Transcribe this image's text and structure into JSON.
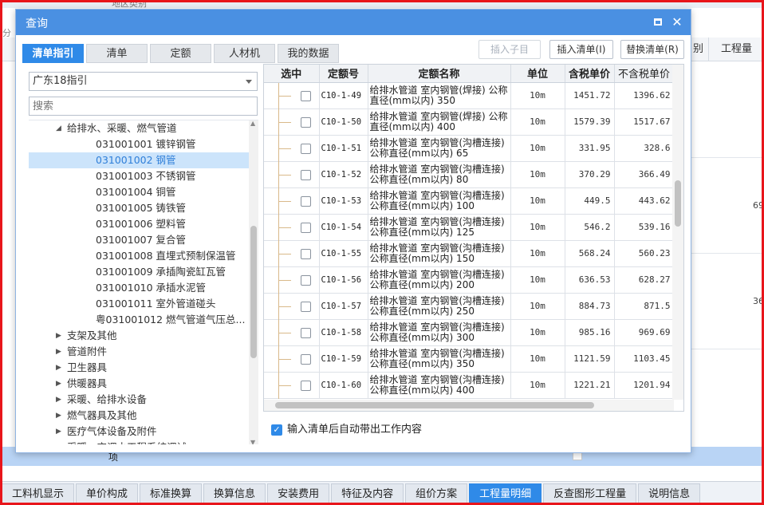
{
  "background": {
    "top_hint": "地区类别",
    "left_label": "分",
    "col_headers": [
      "别",
      "工程量"
    ],
    "right_values": [
      "69",
      "36"
    ],
    "row_label": "项"
  },
  "bottom_tabs": [
    "工料机显示",
    "单价构成",
    "标准换算",
    "换算信息",
    "安装费用",
    "特征及内容",
    "组价方案",
    "工程量明细",
    "反查图形工程量",
    "说明信息"
  ],
  "bottom_tabs_active": "工程量明细",
  "dialog": {
    "title": "查询",
    "tabs": [
      "清单指引",
      "清单",
      "定额",
      "人材机",
      "我的数据"
    ],
    "active_tab": "清单指引",
    "buttons": {
      "insert_child": "插入子目",
      "insert_list": "插入清单(I)",
      "replace_list": "替换清单(R)"
    },
    "select_value": "广东18指引",
    "search_placeholder": "搜索",
    "tree": [
      {
        "label": "给排水、采暖、燃气管道",
        "indent": 48,
        "arrow": "down"
      },
      {
        "label": "031001001  镀锌钢管",
        "indent": 84
      },
      {
        "label": "031001002  钢管",
        "indent": 84,
        "selected": true
      },
      {
        "label": "031001003  不锈钢管",
        "indent": 84
      },
      {
        "label": "031001004  铜管",
        "indent": 84
      },
      {
        "label": "031001005  铸铁管",
        "indent": 84
      },
      {
        "label": "031001006  塑料管",
        "indent": 84
      },
      {
        "label": "031001007  复合管",
        "indent": 84
      },
      {
        "label": "031001008  直埋式预制保温管",
        "indent": 84
      },
      {
        "label": "031001009  承插陶瓷缸瓦管",
        "indent": 84
      },
      {
        "label": "031001010  承插水泥管",
        "indent": 84
      },
      {
        "label": "031001011  室外管道碰头",
        "indent": 84
      },
      {
        "label": "粤031001012  燃气管道气压总...",
        "indent": 84
      },
      {
        "label": "支架及其他",
        "indent": 48,
        "arrow": "right"
      },
      {
        "label": "管道附件",
        "indent": 48,
        "arrow": "right"
      },
      {
        "label": "卫生器具",
        "indent": 48,
        "arrow": "right"
      },
      {
        "label": "供暖器具",
        "indent": 48,
        "arrow": "right"
      },
      {
        "label": "采暖、给排水设备",
        "indent": 48,
        "arrow": "right"
      },
      {
        "label": "燃气器具及其他",
        "indent": 48,
        "arrow": "right"
      },
      {
        "label": "医疗气体设备及附件",
        "indent": 48,
        "arrow": "right"
      },
      {
        "label": "采暖、空调水工程系统调试",
        "indent": 48,
        "arrow": "right"
      }
    ],
    "grid_headers": [
      "选中",
      "定额号",
      "定额名称",
      "单位",
      "含税单价",
      "不含税单价"
    ],
    "rows": [
      {
        "code": "C10-1-49",
        "name": "给排水管道 室内钢管(焊接) 公称直径(mm以内) 350",
        "unit": "10m",
        "tax_price": "1451.72",
        "notax_price": "1396.62"
      },
      {
        "code": "C10-1-50",
        "name": "给排水管道 室内钢管(焊接) 公称直径(mm以内) 400",
        "unit": "10m",
        "tax_price": "1579.39",
        "notax_price": "1517.67"
      },
      {
        "code": "C10-1-51",
        "name": "给排水管道 室内钢管(沟槽连接) 公称直径(mm以内) 65",
        "unit": "10m",
        "tax_price": "331.95",
        "notax_price": "328.6"
      },
      {
        "code": "C10-1-52",
        "name": "给排水管道 室内钢管(沟槽连接) 公称直径(mm以内) 80",
        "unit": "10m",
        "tax_price": "370.29",
        "notax_price": "366.49"
      },
      {
        "code": "C10-1-53",
        "name": "给排水管道 室内钢管(沟槽连接) 公称直径(mm以内) 100",
        "unit": "10m",
        "tax_price": "449.5",
        "notax_price": "443.62"
      },
      {
        "code": "C10-1-54",
        "name": "给排水管道 室内钢管(沟槽连接) 公称直径(mm以内) 125",
        "unit": "10m",
        "tax_price": "546.2",
        "notax_price": "539.16"
      },
      {
        "code": "C10-1-55",
        "name": "给排水管道 室内钢管(沟槽连接) 公称直径(mm以内) 150",
        "unit": "10m",
        "tax_price": "568.24",
        "notax_price": "560.23"
      },
      {
        "code": "C10-1-56",
        "name": "给排水管道 室内钢管(沟槽连接) 公称直径(mm以内) 200",
        "unit": "10m",
        "tax_price": "636.53",
        "notax_price": "628.27"
      },
      {
        "code": "C10-1-57",
        "name": "给排水管道 室内钢管(沟槽连接) 公称直径(mm以内) 250",
        "unit": "10m",
        "tax_price": "884.73",
        "notax_price": "871.5"
      },
      {
        "code": "C10-1-58",
        "name": "给排水管道 室内钢管(沟槽连接) 公称直径(mm以内) 300",
        "unit": "10m",
        "tax_price": "985.16",
        "notax_price": "969.69"
      },
      {
        "code": "C10-1-59",
        "name": "给排水管道 室内钢管(沟槽连接) 公称直径(mm以内) 350",
        "unit": "10m",
        "tax_price": "1121.59",
        "notax_price": "1103.45"
      },
      {
        "code": "C10-1-60",
        "name": "给排水管道 室内钢管(沟槽连接) 公称直径(mm以内) 400",
        "unit": "10m",
        "tax_price": "1221.21",
        "notax_price": "1201.94"
      }
    ],
    "auto_option": {
      "label": "输入清单后自动带出工作内容",
      "checked": true
    }
  },
  "colors": {
    "accent": "#2f8ae8",
    "title_bar": "#4a90e2",
    "frame": "#e8151b",
    "selected_row": "#cce4fb"
  }
}
